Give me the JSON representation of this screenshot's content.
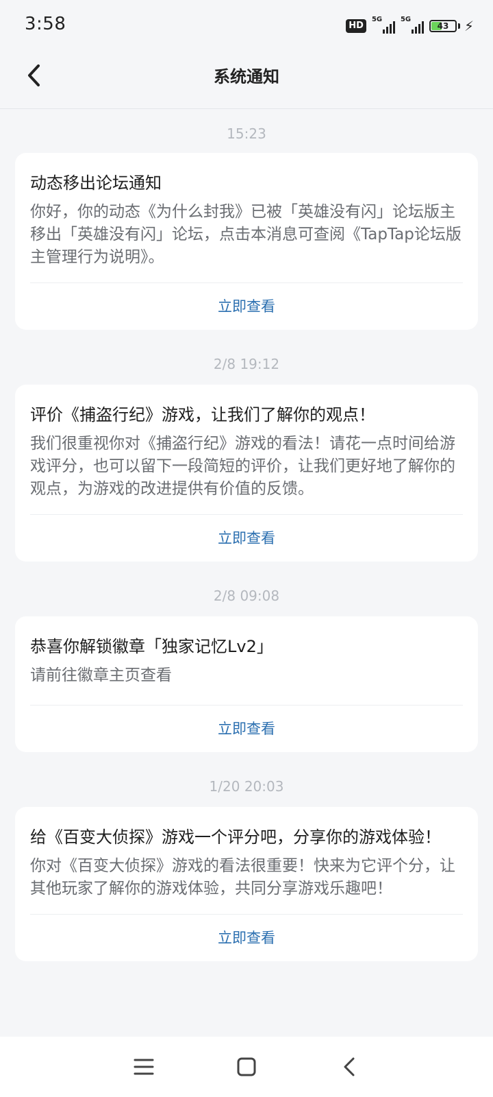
{
  "status_bar": {
    "time": "3:58",
    "hd_label": "HD",
    "signal1_label": "5G",
    "signal2_label": "5G",
    "battery_level": "43",
    "battery_fraction": 0.43,
    "icons": [
      "hd-voice-icon",
      "signal-5g-icon",
      "signal-5g-icon",
      "battery-icon",
      "charging-bolt-icon"
    ]
  },
  "header": {
    "title": "系统通知",
    "back_icon": "chevron-left-icon"
  },
  "notifications": [
    {
      "time": "15:23",
      "title": "动态移出论坛通知",
      "body": "你好，你的动态《为什么封我》已被「英雄没有闪」论坛版主移出「英雄没有闪」论坛，点击本消息可查阅《TapTap论坛版主管理行为说明》。",
      "action": "立即查看"
    },
    {
      "time": "2/8  19:12",
      "title": "评价《捕盗行纪》游戏，让我们了解你的观点！",
      "body": "我们很重视你对《捕盗行纪》游戏的看法！请花一点时间给游戏评分，也可以留下一段简短的评价，让我们更好地了解你的观点，为游戏的改进提供有价值的反馈。",
      "action": "立即查看"
    },
    {
      "time": "2/8  09:08",
      "title": "恭喜你解锁徽章「独家记忆Lv2」",
      "body": "请前往徽章主页查看",
      "action": "立即查看"
    },
    {
      "time": "1/20  20:03",
      "title": "给《百变大侦探》游戏一个评分吧，分享你的游戏体验！",
      "body": "你对《百变大侦探》游戏的看法很重要！快来为它评个分，让其他玩家了解你的游戏体验，共同分享游戏乐趣吧！",
      "action": "立即查看"
    }
  ],
  "nav_bar": {
    "icons": [
      "menu-icon",
      "home-square-icon",
      "back-triangle-icon"
    ]
  },
  "colors": {
    "accent_link": "#2b6fb0",
    "background": "#f5f6f8",
    "card": "#ffffff",
    "battery_fill": "#6bd35a"
  }
}
